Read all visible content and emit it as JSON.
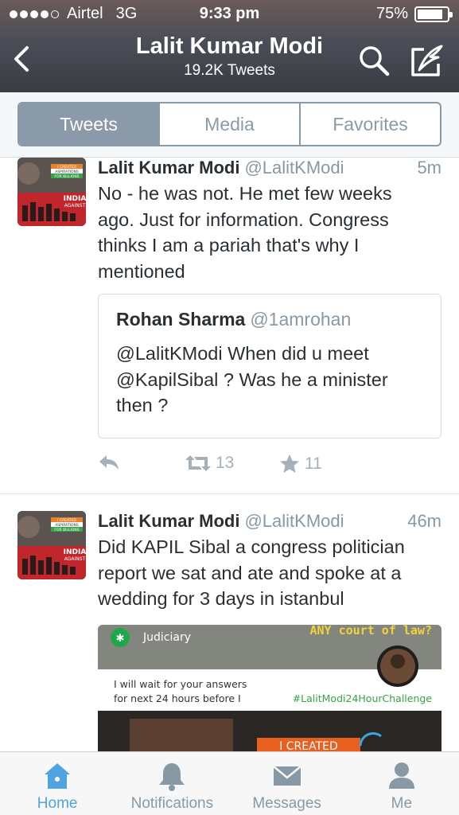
{
  "status_bar": {
    "carrier": "Airtel",
    "network": "3G",
    "time": "9:33 pm",
    "battery": "75%",
    "battery_level": 0.75
  },
  "nav": {
    "title": "Lalit Kumar Modi",
    "subtitle": "19.2K Tweets",
    "back_icon": "chevron-left-icon",
    "search_icon": "search-icon",
    "compose_icon": "compose-icon"
  },
  "segments": [
    {
      "label": "Tweets",
      "active": true
    },
    {
      "label": "Media",
      "active": false
    },
    {
      "label": "Favorites",
      "active": false
    }
  ],
  "tweets": [
    {
      "name": "Lalit Kumar Modi",
      "handle": "@LalitKModi",
      "time": "5m",
      "text_lines": [
        "No - he was not. He met few weeks",
        "ago. Just for information. Congress",
        "thinks I am a pariah that's why I",
        "mentioned"
      ],
      "avatar": {
        "badge_line1": "I CREATED",
        "badge_line2": "ASPIRATIONS",
        "badge_line3": "FOR BILLIONS",
        "banner_line1": "INDIA",
        "banner_line2": "AGAINST"
      },
      "quote": {
        "name": "Rohan Sharma",
        "handle": "@1amrohan",
        "text_lines": [
          "@LalitKModi When did u meet",
          "@KapilSibal ? Was he a minister",
          "then ?"
        ]
      },
      "retweets": "13",
      "favorites": "11"
    },
    {
      "name": "Lalit Kumar Modi",
      "handle": "@LalitKModi",
      "time": "46m",
      "text_lines": [
        "Did KAPIL Sibal a congress politician",
        "report we sat and ate and spoke at a",
        "wedding for 3 days in istanbul"
      ],
      "avatar": {
        "badge_line1": "I CREATED",
        "badge_line2": "ASPIRATIONS",
        "badge_line3": "FOR BILLIONS",
        "banner_line1": "INDIA",
        "banner_line2": "AGAINST"
      },
      "media": {
        "label": "Judiciary",
        "headline": "ANY court of law?",
        "line1": "I will wait for your answers",
        "line2": "for next 24 hours before I",
        "hashtag": "#LalitModi24HourChallenge",
        "banner": "I CREATED"
      }
    }
  ],
  "tabbar": [
    {
      "label": "Home",
      "icon": "home-icon",
      "active": true
    },
    {
      "label": "Notifications",
      "icon": "bell-icon",
      "active": false
    },
    {
      "label": "Messages",
      "icon": "envelope-icon",
      "active": false
    },
    {
      "label": "Me",
      "icon": "person-icon",
      "active": false
    }
  ],
  "colors": {
    "accent": "#4fa3e0",
    "segment": "#8b9aa8",
    "muted": "#8899a6"
  }
}
